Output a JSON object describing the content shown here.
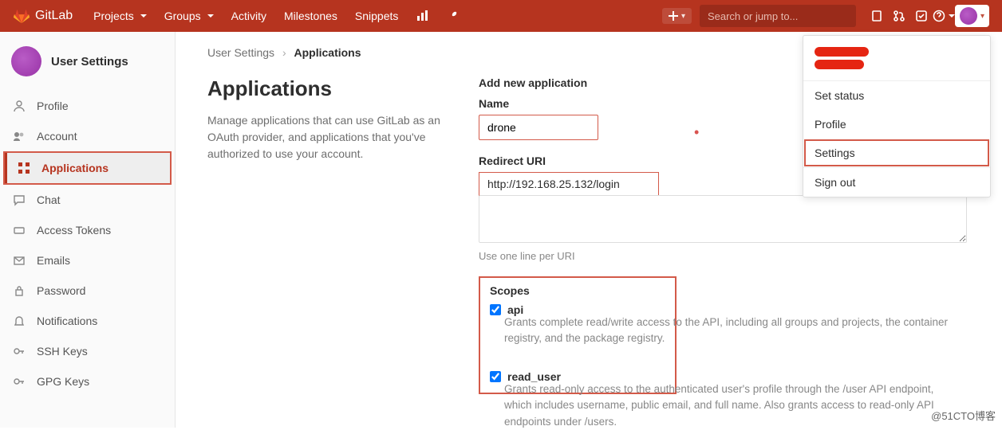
{
  "brand": "GitLab",
  "topnav": {
    "projects": "Projects",
    "groups": "Groups",
    "activity": "Activity",
    "milestones": "Milestones",
    "snippets": "Snippets"
  },
  "search": {
    "placeholder": "Search or jump to..."
  },
  "sidebar": {
    "title": "User Settings",
    "items": [
      {
        "icon": "profile-icon",
        "label": "Profile"
      },
      {
        "icon": "account-icon",
        "label": "Account"
      },
      {
        "icon": "apps-icon",
        "label": "Applications",
        "active": true
      },
      {
        "icon": "chat-icon",
        "label": "Chat"
      },
      {
        "icon": "token-icon",
        "label": "Access Tokens"
      },
      {
        "icon": "email-icon",
        "label": "Emails"
      },
      {
        "icon": "lock-icon",
        "label": "Password"
      },
      {
        "icon": "bell-icon",
        "label": "Notifications"
      },
      {
        "icon": "key-icon",
        "label": "SSH Keys"
      },
      {
        "icon": "key-icon",
        "label": "GPG Keys"
      }
    ]
  },
  "breadcrumb": {
    "root": "User Settings",
    "current": "Applications"
  },
  "page": {
    "heading": "Applications",
    "description": "Manage applications that can use GitLab as an OAuth provider, and applications that you've authorized to use your account."
  },
  "form": {
    "section_title": "Add new application",
    "name_label": "Name",
    "name_value": "drone",
    "redirect_label": "Redirect URI",
    "redirect_value": "http://192.168.25.132/login",
    "redirect_hint": "Use one line per URI",
    "scopes_label": "Scopes",
    "scopes": [
      {
        "key": "api",
        "label": "api",
        "checked": true,
        "desc": "Grants complete read/write access to the API, including all groups and projects, the container registry, and the package registry."
      },
      {
        "key": "read_user",
        "label": "read_user",
        "checked": true,
        "desc": "Grants read-only access to the authenticated user's profile through the /user API endpoint, which includes username, public email, and full name. Also grants access to read-only API endpoints under /users."
      }
    ]
  },
  "user_menu": {
    "set_status": "Set status",
    "profile": "Profile",
    "settings": "Settings",
    "sign_out": "Sign out"
  },
  "watermark": "@51CTO博客"
}
